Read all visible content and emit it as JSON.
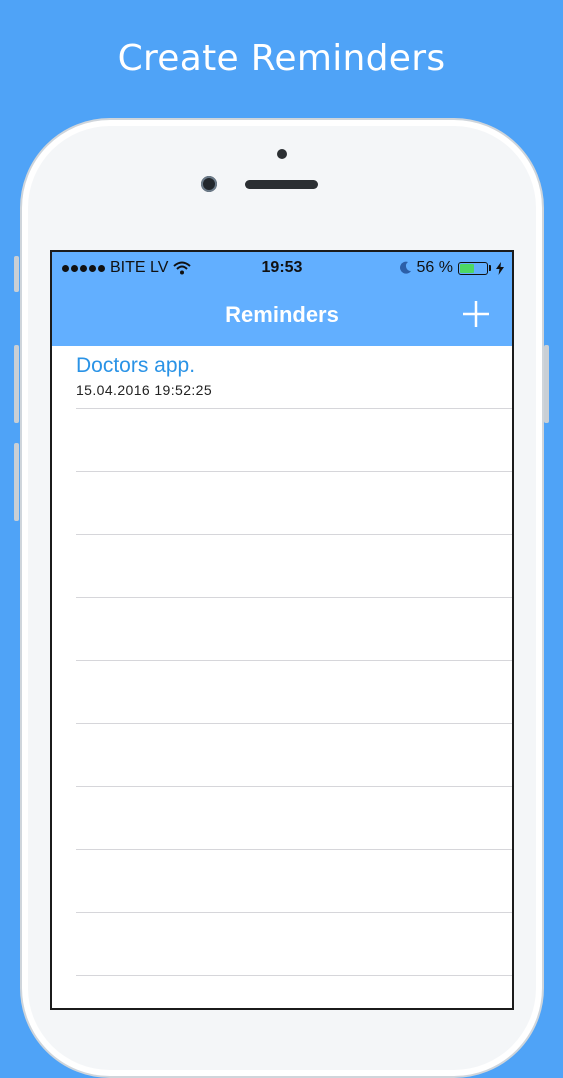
{
  "headline": "Create Reminders",
  "status_bar": {
    "carrier": "BITE LV",
    "time": "19:53",
    "battery_percent": "56 %",
    "battery_level": 0.56
  },
  "navbar": {
    "title": "Reminders",
    "add_icon": "plus-icon"
  },
  "reminders": [
    {
      "title": "Doctors app.",
      "date": "15.04.2016 19:52:25"
    }
  ],
  "colors": {
    "background": "#4fa3f7",
    "navbar": "#62afff",
    "item_title": "#2a93e6"
  }
}
